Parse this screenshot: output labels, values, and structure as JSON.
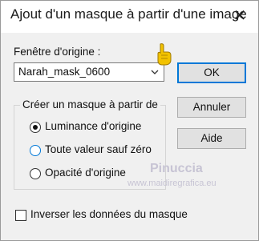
{
  "dialog": {
    "title": "Ajout d'un masque à partir d'une image",
    "close_label": "✕"
  },
  "source": {
    "label": "Fenêtre d'origine :",
    "selected": "Narah_mask_0600"
  },
  "buttons": {
    "ok": "OK",
    "cancel": "Annuler",
    "help": "Aide"
  },
  "mask_group": {
    "legend": "Créer un masque à partir de",
    "options": [
      {
        "label": "Luminance d'origine",
        "checked": true
      },
      {
        "label": "Toute valeur sauf zéro",
        "checked": false
      },
      {
        "label": "Opacité d'origine",
        "checked": false
      }
    ]
  },
  "invert": {
    "label": "Inverser les données du masque",
    "checked": false
  },
  "watermark": {
    "name": "Pinuccia",
    "url": "www.maidiregrafica.eu"
  },
  "colors": {
    "accent": "#0078d7",
    "window_bg": "#f0f0f0",
    "pointer": "#f2c200"
  },
  "icons": {
    "close": "close-icon",
    "dropdown": "chevron-down-icon",
    "pointer": "pointing-hand-icon"
  }
}
